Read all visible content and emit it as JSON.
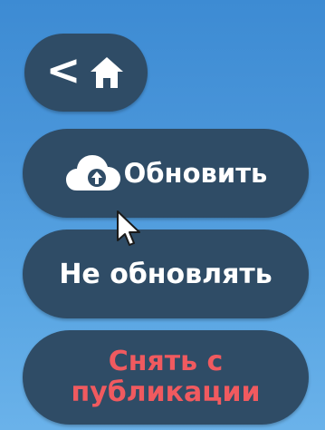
{
  "nav": {
    "back_glyph": "<",
    "back_icon": "chevron-left-icon",
    "home_icon": "home-icon"
  },
  "update_button": {
    "label": "Обновить",
    "icon": "cloud-upload-icon"
  },
  "skip_button": {
    "label": "Не обновлять"
  },
  "unpublish_button": {
    "label_line1": "Снять с",
    "label_line2": "публикации"
  },
  "colors": {
    "background_top": "#3d8bd3",
    "background_bottom": "#6ab2ea",
    "button_bg": "#2f4c66",
    "text_primary": "#ffffff",
    "text_danger": "#f05a5f"
  }
}
